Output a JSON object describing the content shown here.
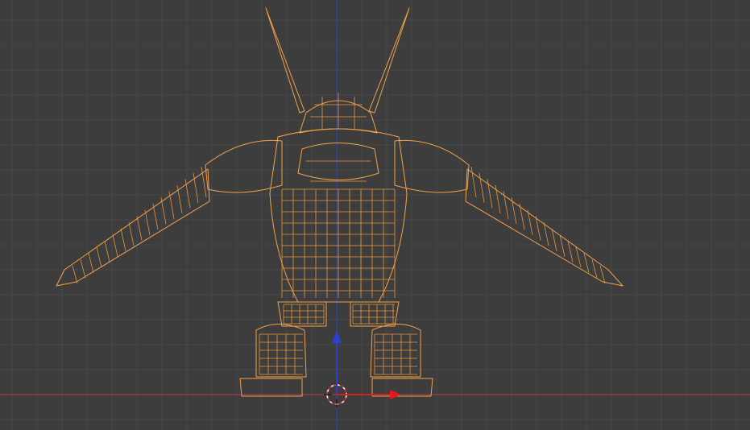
{
  "viewport": {
    "editor": "3D View",
    "shading": "wireframe",
    "view": "front-orthographic",
    "background_color": "#3d3d3d",
    "grid_color": "#4a4a4a",
    "x_axis_color": "#c03030",
    "z_axis_color": "#2e3cc9",
    "mesh_color": "#f2a24a",
    "icons": {
      "cursor": "3d-cursor-icon",
      "gizmo_z": "z-axis-arrow-icon",
      "gizmo_x": "x-axis-arrow-icon"
    }
  },
  "object": {
    "type": "mesh",
    "selected": true,
    "description_icon": "creature-mesh-wireframe"
  }
}
